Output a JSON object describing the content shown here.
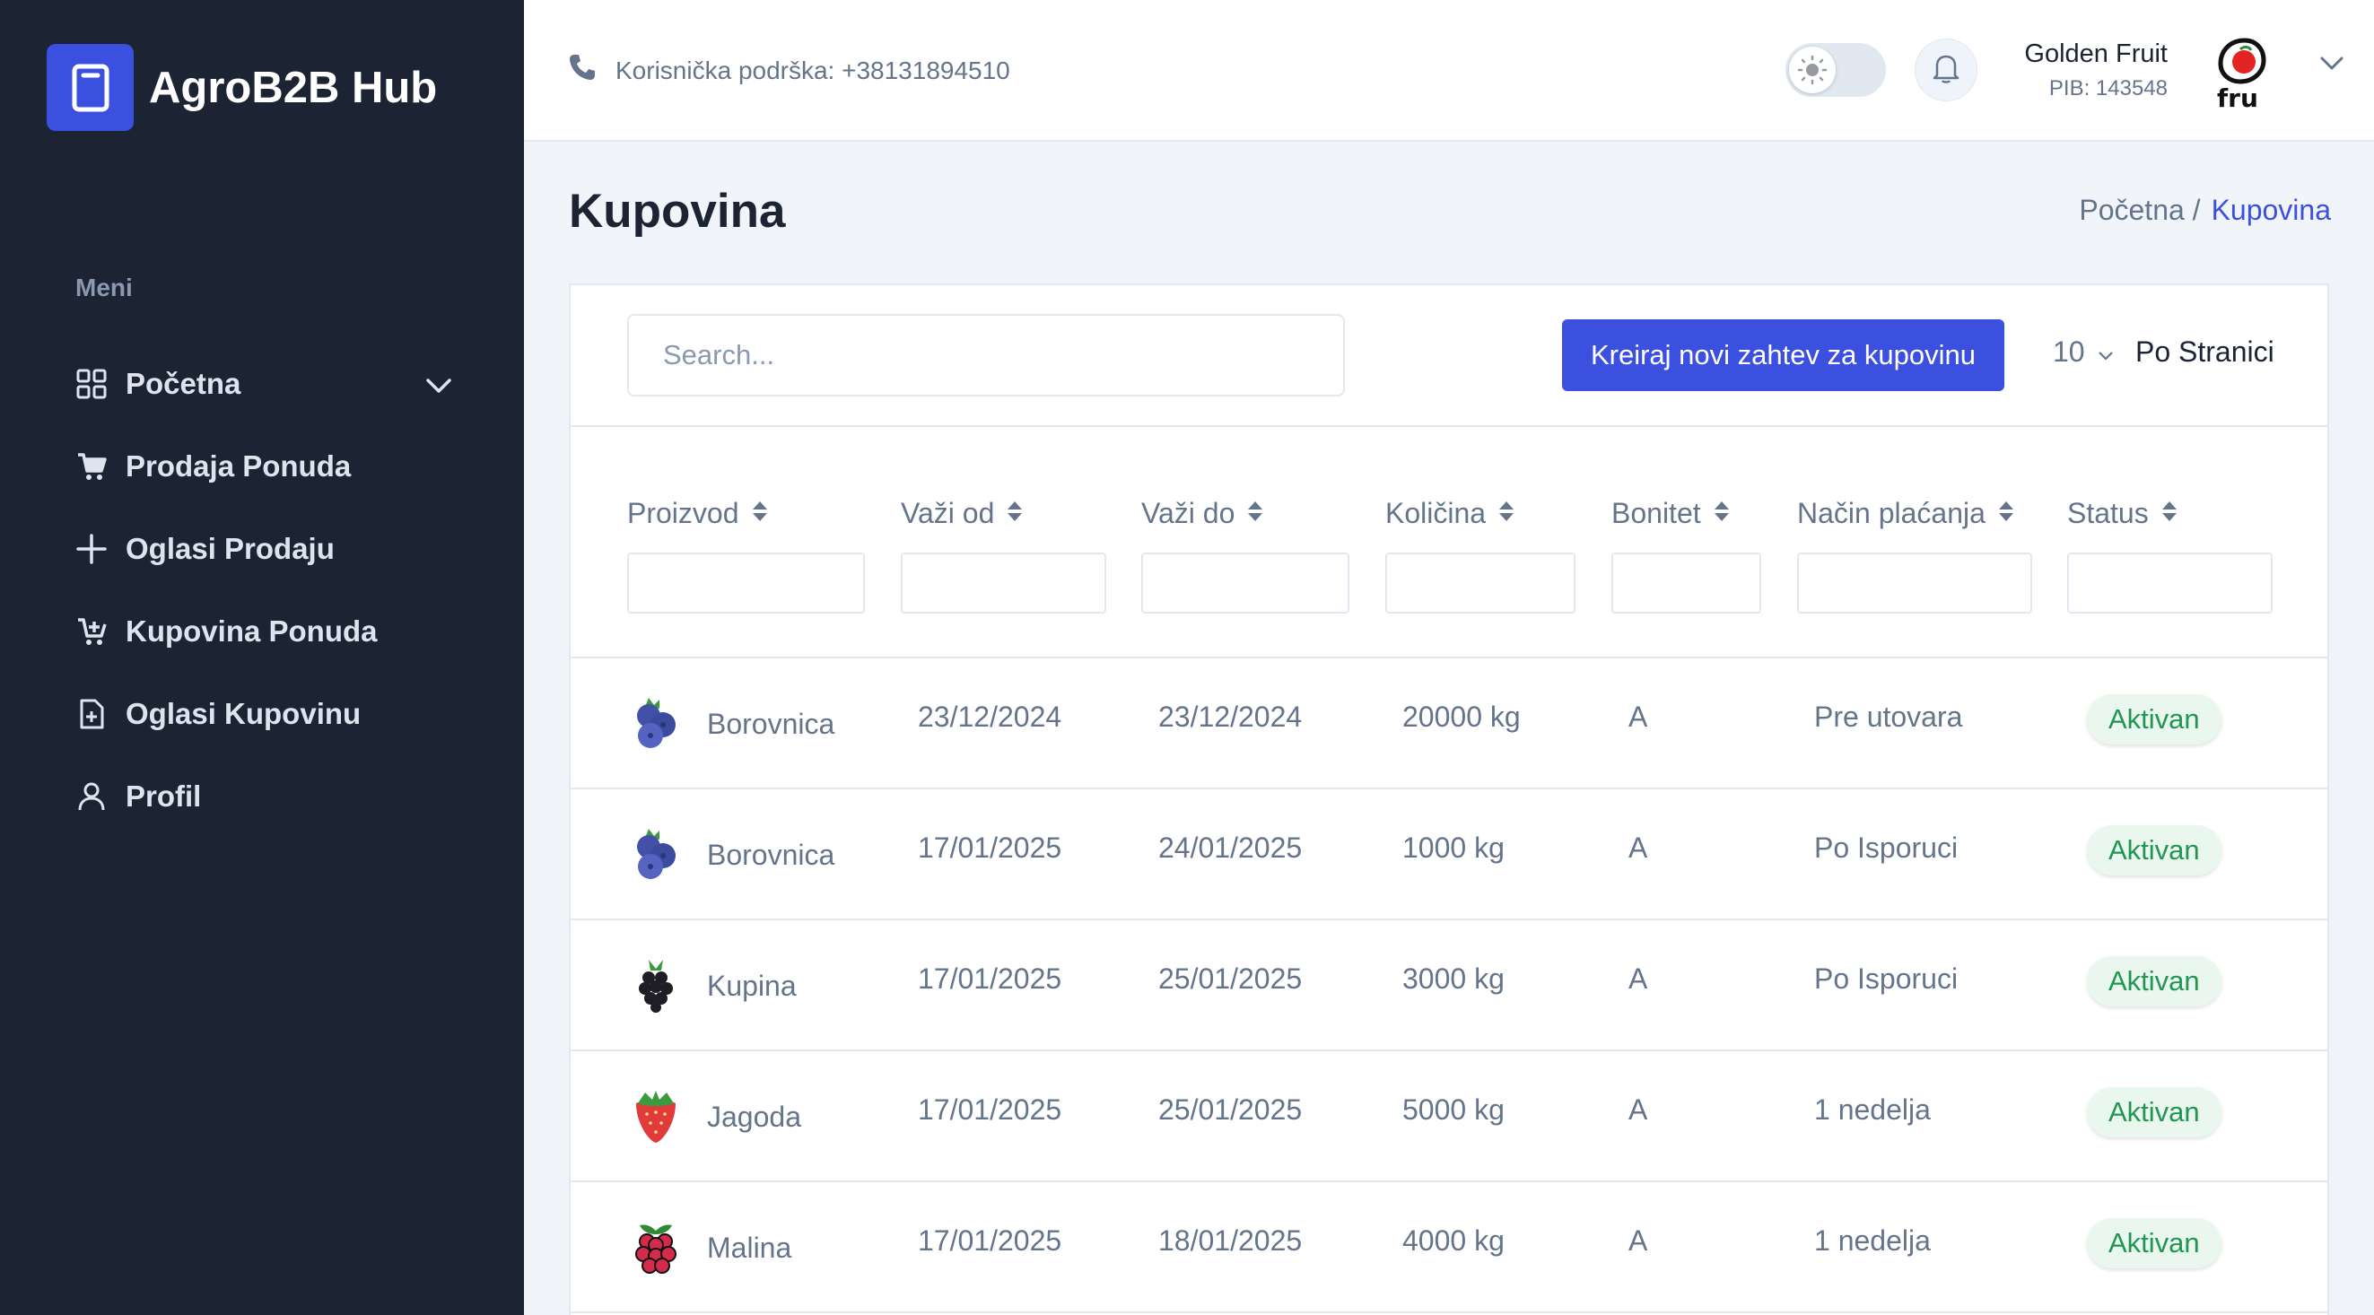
{
  "sidebar": {
    "app_name": "AgroB2B Hub",
    "menu_heading": "Meni",
    "items": [
      {
        "label": "Početna",
        "icon": "grid-icon"
      },
      {
        "label": "Prodaja Ponuda",
        "icon": "cart-icon"
      },
      {
        "label": "Oglasi Prodaju",
        "icon": "plus-icon"
      },
      {
        "label": "Kupovina Ponuda",
        "icon": "cart-add-icon"
      },
      {
        "label": "Oglasi Kupovinu",
        "icon": "document-plus-icon"
      },
      {
        "label": "Profil",
        "icon": "user-icon"
      }
    ]
  },
  "header": {
    "support_text": "Korisnička podrška: +38131894510",
    "user_name": "Golden Fruit",
    "user_pib": "PIB: 143548",
    "avatar_text": "fru"
  },
  "page": {
    "title": "Kupovina",
    "breadcrumb_home": "Početna /",
    "breadcrumb_current": "Kupovina"
  },
  "toolbar": {
    "search_placeholder": "Search...",
    "create_label": "Kreiraj novi zahtev za kupovinu",
    "per_page_value": "10",
    "per_page_label": "Po Stranici"
  },
  "table": {
    "columns": [
      "Proizvod",
      "Važi od",
      "Važi do",
      "Količina",
      "Bonitet",
      "Način plaćanja",
      "Status"
    ],
    "rows": [
      {
        "product": "Borovnica",
        "fruit": "blueberry",
        "from": "23/12/2024",
        "to": "23/12/2024",
        "qty": "20000 kg",
        "bonitet": "A",
        "payment": "Pre utovara",
        "status": "Aktivan"
      },
      {
        "product": "Borovnica",
        "fruit": "blueberry",
        "from": "17/01/2025",
        "to": "24/01/2025",
        "qty": "1000 kg",
        "bonitet": "A",
        "payment": "Po Isporuci",
        "status": "Aktivan"
      },
      {
        "product": "Kupina",
        "fruit": "blackberry",
        "from": "17/01/2025",
        "to": "25/01/2025",
        "qty": "3000 kg",
        "bonitet": "A",
        "payment": "Po Isporuci",
        "status": "Aktivan"
      },
      {
        "product": "Jagoda",
        "fruit": "strawberry",
        "from": "17/01/2025",
        "to": "25/01/2025",
        "qty": "5000 kg",
        "bonitet": "A",
        "payment": "1 nedelja",
        "status": "Aktivan"
      },
      {
        "product": "Malina",
        "fruit": "raspberry",
        "from": "17/01/2025",
        "to": "18/01/2025",
        "qty": "4000 kg",
        "bonitet": "A",
        "payment": "1 nedelja",
        "status": "Aktivan"
      }
    ]
  },
  "colors": {
    "sidebar_bg": "#1c2434",
    "primary": "#3c50e0",
    "status_green": "#219653"
  }
}
